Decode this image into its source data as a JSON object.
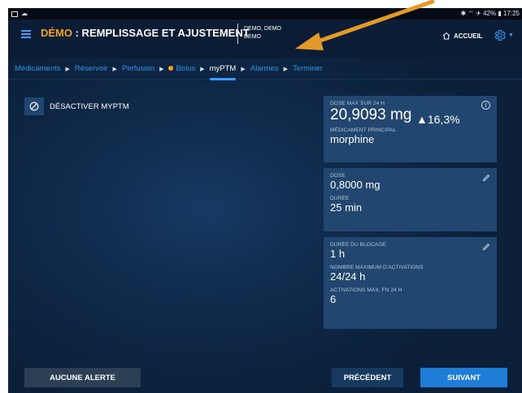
{
  "status_bar": {
    "right_text": "✱ ⌔ ✈ 42% ▮ 17:25"
  },
  "header": {
    "title_accent": "DÉMO",
    "title_rest": " : REMPLISSAGE ET AJUSTEMENT",
    "demo_line1": "DEMO, DEMO",
    "demo_line2": "DEMO",
    "home_label": "ACCUEIL"
  },
  "breadcrumbs": [
    "Médicaments",
    "Réservoir",
    "Perfusion",
    "Bolus",
    "myPTM",
    "Alarmes",
    "Terminer"
  ],
  "breadcrumb_current": "myPTM",
  "disable_label": "DÉSACTIVER MYPTM",
  "cards": {
    "dose_max_label": "DOSE MAX SUR 24 H",
    "dose_max_value": "20,9093 mg",
    "dose_max_change": "▲16,3%",
    "medication_label": "MÉDICAMENT PRINCIPAL",
    "medication_value": "morphine",
    "dose_label": "DOSE",
    "dose_value": "0,8000 mg",
    "duration_label": "DURÉE",
    "duration_value": "25 min",
    "lockout_label": "DURÉE DU BLOCAGE",
    "lockout_value": "1 h",
    "max_activations_label": "NOMBRE MAXIMUM D'ACTIVATIONS",
    "max_activations_value": "24/24 h",
    "activations_label": "ACTIVATIONS MAX. FN 24 H",
    "activations_value": "6"
  },
  "buttons": {
    "no_alert": "AUCUNE ALERTE",
    "previous": "PRÉCÉDENT",
    "next": "SUIVANT"
  },
  "colors": {
    "accent_orange": "#f5a21c",
    "link_blue": "#2e93e6",
    "card_bg": "#21466f",
    "primary_button": "#1e7dd6"
  }
}
